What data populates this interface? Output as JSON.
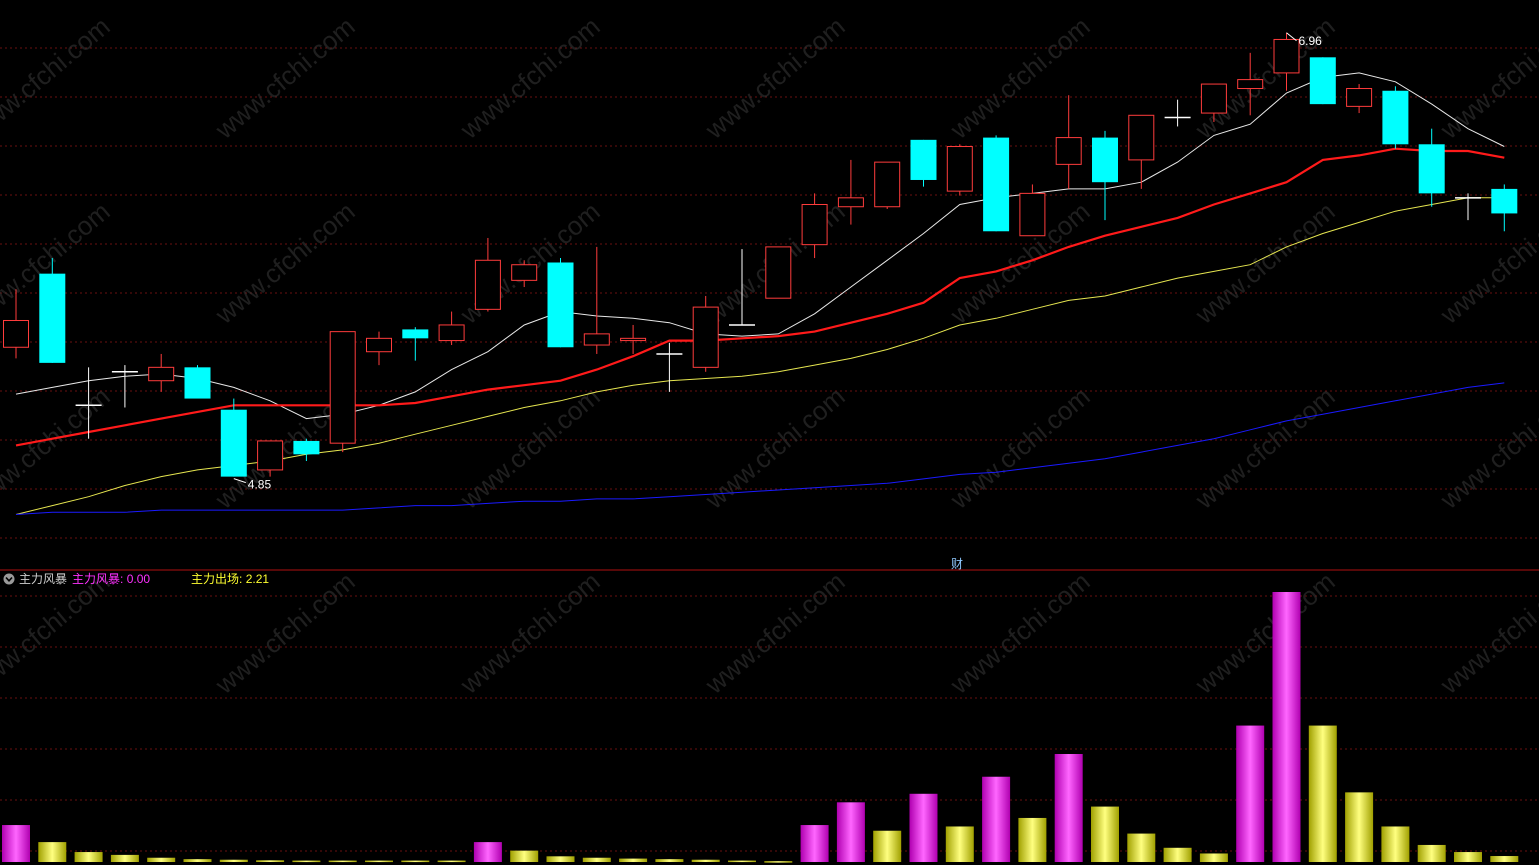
{
  "indicator": {
    "name": "主力风暴",
    "series1_label": "主力风暴",
    "series1_value": "0.00",
    "series2_label": "主力出场",
    "series2_value": "2.21"
  },
  "finance_marker": "财",
  "watermark": "www.cfchi.com",
  "colors": {
    "background": "#000000",
    "up_candle": "#ff3c3c",
    "down_candle": "#00ffff",
    "cross_candle": "#ffffff",
    "ma5": "#e8e8e8",
    "ma10": "#ff1a1a",
    "ma20": "#e6e650",
    "ma60": "#1a1aff",
    "bar_magenta": "#ff00ff",
    "bar_yellow": "#ffff00",
    "grid": "#6a1010",
    "separator": "#b01010"
  },
  "chart_data": [
    {
      "type": "candlestick",
      "title": "",
      "high_label": "6.96",
      "low_label": "4.85",
      "ylim": [
        4.65,
        7.08
      ],
      "candles": [
        {
          "o": 5.55,
          "h": 5.81,
          "l": 5.5,
          "c": 5.67
        },
        {
          "o": 5.88,
          "h": 5.95,
          "l": 5.48,
          "c": 5.48
        },
        {
          "o": 5.29,
          "h": 5.46,
          "l": 5.14,
          "c": 5.29
        },
        {
          "o": 5.44,
          "h": 5.47,
          "l": 5.28,
          "c": 5.44
        },
        {
          "o": 5.4,
          "h": 5.52,
          "l": 5.35,
          "c": 5.46
        },
        {
          "o": 5.46,
          "h": 5.47,
          "l": 5.32,
          "c": 5.32
        },
        {
          "o": 5.27,
          "h": 5.32,
          "l": 4.97,
          "c": 4.97
        },
        {
          "o": 5.0,
          "h": 5.13,
          "l": 4.97,
          "c": 5.13
        },
        {
          "o": 5.13,
          "h": 5.14,
          "l": 5.04,
          "c": 5.07
        },
        {
          "o": 5.12,
          "h": 5.62,
          "l": 5.08,
          "c": 5.62
        },
        {
          "o": 5.53,
          "h": 5.62,
          "l": 5.47,
          "c": 5.59
        },
        {
          "o": 5.63,
          "h": 5.64,
          "l": 5.49,
          "c": 5.59
        },
        {
          "o": 5.58,
          "h": 5.71,
          "l": 5.56,
          "c": 5.65
        },
        {
          "o": 5.72,
          "h": 6.04,
          "l": 5.71,
          "c": 5.94
        },
        {
          "o": 5.85,
          "h": 5.94,
          "l": 5.82,
          "c": 5.92
        },
        {
          "o": 5.93,
          "h": 5.95,
          "l": 5.55,
          "c": 5.55
        },
        {
          "o": 5.56,
          "h": 6.0,
          "l": 5.52,
          "c": 5.61
        },
        {
          "o": 5.58,
          "h": 5.65,
          "l": 5.52,
          "c": 5.59
        },
        {
          "o": 5.52,
          "h": 5.57,
          "l": 5.35,
          "c": 5.52
        },
        {
          "o": 5.46,
          "h": 5.78,
          "l": 5.44,
          "c": 5.73
        },
        {
          "o": 5.65,
          "h": 5.99,
          "l": 5.65,
          "c": 5.65
        },
        {
          "o": 5.77,
          "h": 6.0,
          "l": 5.77,
          "c": 6.0
        },
        {
          "o": 6.01,
          "h": 6.24,
          "l": 5.95,
          "c": 6.19
        },
        {
          "o": 6.18,
          "h": 6.39,
          "l": 6.1,
          "c": 6.22
        },
        {
          "o": 6.18,
          "h": 6.36,
          "l": 6.17,
          "c": 6.38
        },
        {
          "o": 6.48,
          "h": 6.48,
          "l": 6.27,
          "c": 6.3
        },
        {
          "o": 6.25,
          "h": 6.46,
          "l": 6.23,
          "c": 6.45
        },
        {
          "o": 6.49,
          "h": 6.5,
          "l": 6.07,
          "c": 6.07
        },
        {
          "o": 6.05,
          "h": 6.28,
          "l": 6.05,
          "c": 6.24
        },
        {
          "o": 6.37,
          "h": 6.68,
          "l": 6.26,
          "c": 6.49
        },
        {
          "o": 6.49,
          "h": 6.52,
          "l": 6.12,
          "c": 6.29
        },
        {
          "o": 6.39,
          "h": 6.57,
          "l": 6.26,
          "c": 6.59
        },
        {
          "o": 6.58,
          "h": 6.66,
          "l": 6.54,
          "c": 6.58
        },
        {
          "o": 6.6,
          "h": 6.7,
          "l": 6.56,
          "c": 6.73
        },
        {
          "o": 6.71,
          "h": 6.87,
          "l": 6.59,
          "c": 6.75
        },
        {
          "o": 6.78,
          "h": 6.96,
          "l": 6.7,
          "c": 6.93
        },
        {
          "o": 6.85,
          "h": 6.85,
          "l": 6.64,
          "c": 6.64
        },
        {
          "o": 6.63,
          "h": 6.73,
          "l": 6.6,
          "c": 6.71
        },
        {
          "o": 6.7,
          "h": 6.72,
          "l": 6.44,
          "c": 6.46
        },
        {
          "o": 6.46,
          "h": 6.53,
          "l": 6.18,
          "c": 6.24
        },
        {
          "o": 6.22,
          "h": 6.24,
          "l": 6.12,
          "c": 6.22
        },
        {
          "o": 6.26,
          "h": 6.28,
          "l": 6.07,
          "c": 6.15
        }
      ],
      "ma": [
        {
          "name": "MA5",
          "values": [
            5.34,
            5.37,
            5.4,
            5.42,
            5.43,
            5.41,
            5.37,
            5.31,
            5.23,
            5.25,
            5.29,
            5.35,
            5.45,
            5.53,
            5.65,
            5.71,
            5.69,
            5.68,
            5.66,
            5.61,
            5.6,
            5.61,
            5.7,
            5.82,
            5.94,
            6.06,
            6.19,
            6.22,
            6.24,
            6.26,
            6.26,
            6.29,
            6.38,
            6.5,
            6.55,
            6.69,
            6.76,
            6.78,
            6.74,
            6.64,
            6.53,
            6.45
          ]
        },
        {
          "name": "MA10",
          "values": [
            5.11,
            5.14,
            5.17,
            5.2,
            5.23,
            5.26,
            5.29,
            5.29,
            5.29,
            5.29,
            5.29,
            5.3,
            5.33,
            5.36,
            5.38,
            5.4,
            5.45,
            5.51,
            5.58,
            5.58,
            5.59,
            5.6,
            5.62,
            5.66,
            5.7,
            5.75,
            5.86,
            5.89,
            5.94,
            6.0,
            6.05,
            6.09,
            6.13,
            6.19,
            6.24,
            6.29,
            6.39,
            6.41,
            6.44,
            6.43,
            6.43,
            6.4
          ]
        },
        {
          "name": "MA20",
          "values": [
            4.8,
            4.84,
            4.88,
            4.93,
            4.97,
            5.0,
            5.02,
            5.04,
            5.07,
            5.09,
            5.12,
            5.16,
            5.2,
            5.24,
            5.28,
            5.31,
            5.35,
            5.38,
            5.4,
            5.41,
            5.42,
            5.44,
            5.47,
            5.5,
            5.54,
            5.59,
            5.65,
            5.68,
            5.72,
            5.76,
            5.78,
            5.82,
            5.86,
            5.89,
            5.92,
            6.0,
            6.06,
            6.11,
            6.16,
            6.19,
            6.22,
            6.22
          ]
        },
        {
          "name": "MA60",
          "values": [
            4.8,
            4.81,
            4.81,
            4.81,
            4.82,
            4.82,
            4.82,
            4.82,
            4.82,
            4.82,
            4.83,
            4.84,
            4.84,
            4.85,
            4.86,
            4.86,
            4.87,
            4.87,
            4.88,
            4.89,
            4.9,
            4.91,
            4.92,
            4.93,
            4.94,
            4.96,
            4.98,
            4.99,
            5.01,
            5.03,
            5.05,
            5.08,
            5.11,
            5.14,
            5.18,
            5.22,
            5.25,
            5.28,
            5.31,
            5.34,
            5.37,
            5.39
          ]
        }
      ]
    },
    {
      "type": "bar",
      "title": "主力风暴",
      "ylim": [
        0,
        9.5
      ],
      "series": [
        {
          "name": "主力风暴",
          "values": [
            1.3,
            0,
            0,
            0,
            0,
            0,
            0,
            0,
            0,
            0,
            0,
            0,
            0,
            0.7,
            0,
            0,
            0,
            0,
            0,
            0,
            0,
            0,
            1.3,
            2.1,
            0,
            2.4,
            0,
            3.0,
            0,
            3.8,
            0,
            0,
            0,
            0,
            4.8,
            9.5,
            0,
            0,
            0,
            0,
            0,
            0
          ]
        },
        {
          "name": "主力出场",
          "values": [
            0,
            0.7,
            0.35,
            0.25,
            0.15,
            0.1,
            0.08,
            0.06,
            0.05,
            0.05,
            0.05,
            0.05,
            0.05,
            0,
            0.4,
            0.2,
            0.15,
            0.12,
            0.1,
            0.08,
            0.05,
            0.03,
            0,
            0,
            1.1,
            0,
            1.25,
            0,
            1.55,
            0,
            1.95,
            1.0,
            0.5,
            0.3,
            0,
            0,
            4.8,
            2.45,
            1.25,
            0.6,
            0.35,
            0.21
          ]
        }
      ]
    }
  ]
}
